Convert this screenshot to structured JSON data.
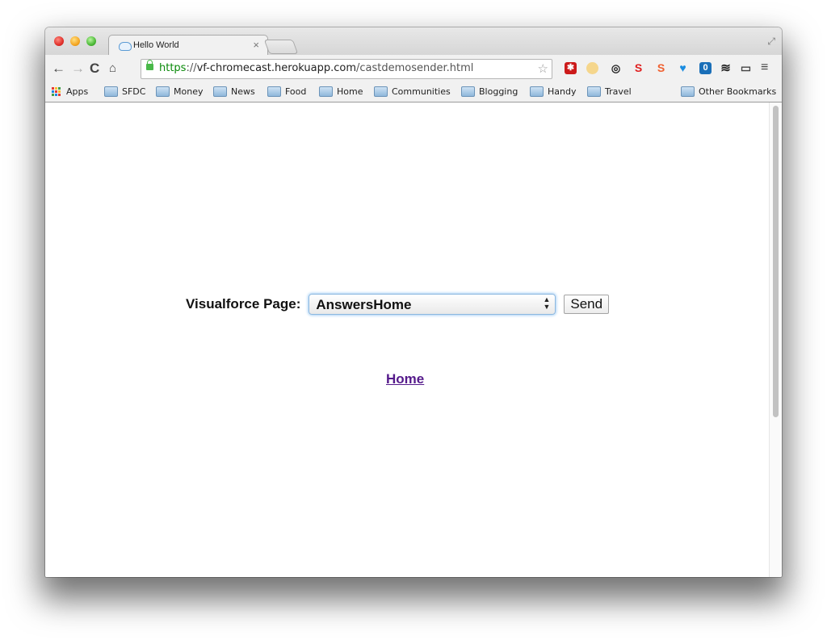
{
  "browser": {
    "tab": {
      "title": "Hello World",
      "close_glyph": "×"
    },
    "fullscreen_glyph": "⤢",
    "nav": {
      "back": "←",
      "forward": "→",
      "reload": "C",
      "home": "⌂"
    },
    "url": {
      "scheme": "https",
      "separator": "://",
      "host": "vf-chromecast.herokuapp.com",
      "path": "/castdemosender.html"
    },
    "star_glyph": "☆",
    "extensions": [
      {
        "name": "lastpass-extension",
        "glyph": "✱"
      },
      {
        "name": "smiley-extension",
        "glyph": ""
      },
      {
        "name": "sync-extension",
        "glyph": "◎"
      },
      {
        "name": "s-red-extension",
        "glyph": "S"
      },
      {
        "name": "s-orange-extension",
        "glyph": "S"
      },
      {
        "name": "heart-extension",
        "glyph": "♥"
      },
      {
        "name": "counter-extension",
        "glyph": "0"
      },
      {
        "name": "buffer-extension",
        "glyph": "≋"
      },
      {
        "name": "cast-extension",
        "glyph": "▭"
      }
    ],
    "menu_glyph": "≡",
    "bookmarks": {
      "apps_label": "Apps",
      "items": [
        "SFDC",
        "Money",
        "News",
        "Food",
        "Home",
        "Communities",
        "Blogging",
        "Handy",
        "Travel"
      ],
      "other_label": "Other Bookmarks"
    }
  },
  "page": {
    "form_label": "Visualforce Page:",
    "select_value": "AnswersHome",
    "send_label": "Send",
    "home_link": "Home"
  },
  "colors": {
    "link_visited": "#551a8b",
    "url_scheme": "#0a8a0a",
    "select_focus": "#a9d1f5"
  }
}
